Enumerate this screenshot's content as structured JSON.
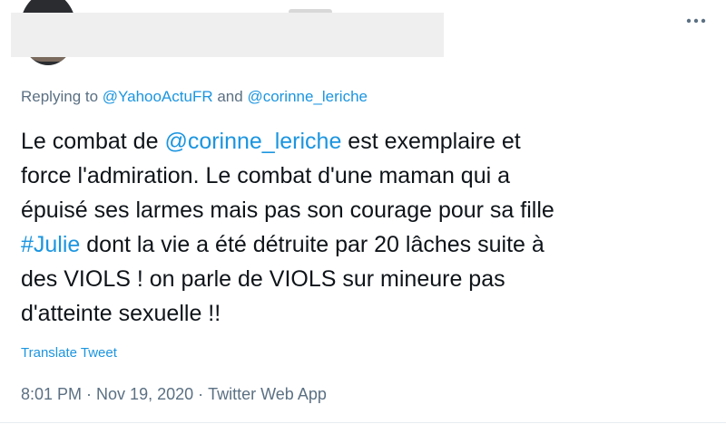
{
  "header": {
    "more_icon": "more-horizontal-icon"
  },
  "reply": {
    "prefix": "Replying to ",
    "mention_1": "@YahooActuFR",
    "joiner": " and ",
    "mention_2": "@corinne_leriche"
  },
  "tweet": {
    "line1_a": "Le combat de ",
    "line1_mention": "@corinne_leriche",
    "line1_b": " est exemplaire et",
    "line2": "force l'admiration. Le combat d'une maman qui a",
    "line3": "épuisé ses larmes mais pas son courage pour sa fille",
    "line4_hashtag": "#Julie",
    "line4_b": " dont la vie a été détruite par 20 lâches suite à",
    "line5": "des VIOLS ! on parle de VIOLS sur mineure pas",
    "line6": "d'atteinte sexuelle !!"
  },
  "translate_label": "Translate Tweet",
  "meta": {
    "time": "8:01 PM",
    "separator": "·",
    "date": "Nov 19, 2020",
    "source": "Twitter Web App"
  },
  "colors": {
    "link": "#1b95e0",
    "secondary_text": "#5b7083",
    "text": "#0f1419"
  }
}
